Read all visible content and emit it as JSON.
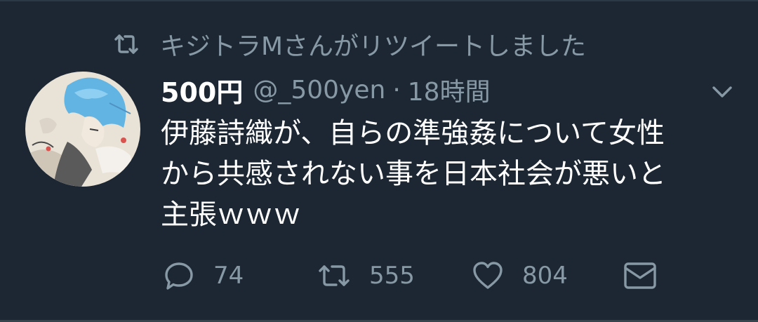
{
  "retweet_context": {
    "icon": "retweet-icon",
    "text": "キジトラMさんがリツイートしました"
  },
  "tweet": {
    "display_name": "500円",
    "handle": "@_500yen",
    "separator": "·",
    "timestamp": "18時間",
    "body_lines": [
      "伊藤詩織が、自らの準強姦について女性",
      "から共感されない事を日本社会が悪いと",
      "主張ｗｗｗ"
    ]
  },
  "actions": {
    "reply": {
      "icon": "reply-icon",
      "count": "74"
    },
    "retweet": {
      "icon": "retweet-icon",
      "count": "555"
    },
    "like": {
      "icon": "heart-icon",
      "count": "804"
    },
    "dm": {
      "icon": "mail-icon"
    }
  },
  "colors": {
    "background": "#1c2733",
    "secondary_text": "#8899a6",
    "primary_text": "#ffffff"
  }
}
